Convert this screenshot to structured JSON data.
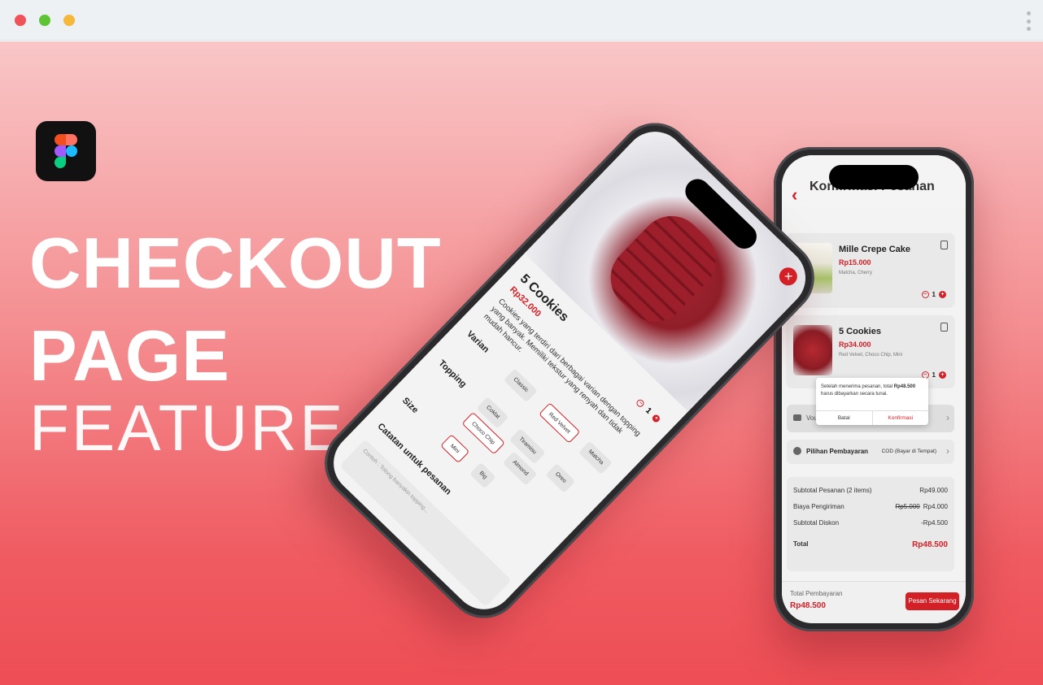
{
  "headline": {
    "line1": "CHECKOUT",
    "line2": "PAGE",
    "line3": "FEATURE"
  },
  "back_phone": {
    "title": "Konfirmasi Pesanan",
    "items": [
      {
        "name": "Mille Crepe Cake",
        "price": "Rp15.000",
        "variant": "Matcha, Cherry",
        "qty": "1"
      },
      {
        "name": "5 Cookies",
        "price": "Rp34.000",
        "variant": "Red Velvet, Choco Chip, Mini",
        "qty": "1"
      }
    ],
    "dialog": {
      "text_prefix": "Setelah menerima pesanan, total",
      "amount": "Rp48.500",
      "text_suffix": "harus dibayarkan secara tunai.",
      "cancel": "Batal",
      "confirm": "Konfirmasi"
    },
    "voucher_label": "Voucher",
    "payment": {
      "label": "Pilihan Pembayaran",
      "value": "COD (Bayar di Tempat)"
    },
    "summary": {
      "subtotal_label": "Subtotal Pesanan (2 items)",
      "subtotal_value": "Rp49.000",
      "shipping_label": "Biaya Pengiriman",
      "shipping_old": "Rp5.000",
      "shipping_value": "Rp4.000",
      "discount_label": "Subtotal Diskon",
      "discount_value": "-Rp4.500",
      "total_label": "Total",
      "total_value": "Rp48.500"
    },
    "footer": {
      "label": "Total Pembayaran",
      "amount": "Rp48.500",
      "button": "Pesan Sekarang"
    }
  },
  "front_phone": {
    "title": "5 Cookies",
    "price": "Rp32.000",
    "qty": "1",
    "description": "Cookies yang terdiri dari berbagai varian dengan topping yang banyak. Memiliki tekstur yang renyah dan tidak mudah hancur.",
    "sections": {
      "varian": "Varian",
      "topping": "Topping",
      "size": "Size",
      "note": "Catatan untuk pesanan"
    },
    "varian_chips": [
      "Classic",
      "Red Velvet",
      "Matcha"
    ],
    "topping_chips": [
      "Coklat",
      "Tiramisu",
      "Oreo",
      "Choco Chip",
      "Almond"
    ],
    "size_chips": [
      "Mini",
      "Big"
    ],
    "note_placeholder": "Contoh : Tolong banyakin topping..."
  },
  "colors": {
    "accent": "#d32027",
    "bg_top": "#f9c6c7",
    "bg_bottom": "#ee4e55"
  }
}
